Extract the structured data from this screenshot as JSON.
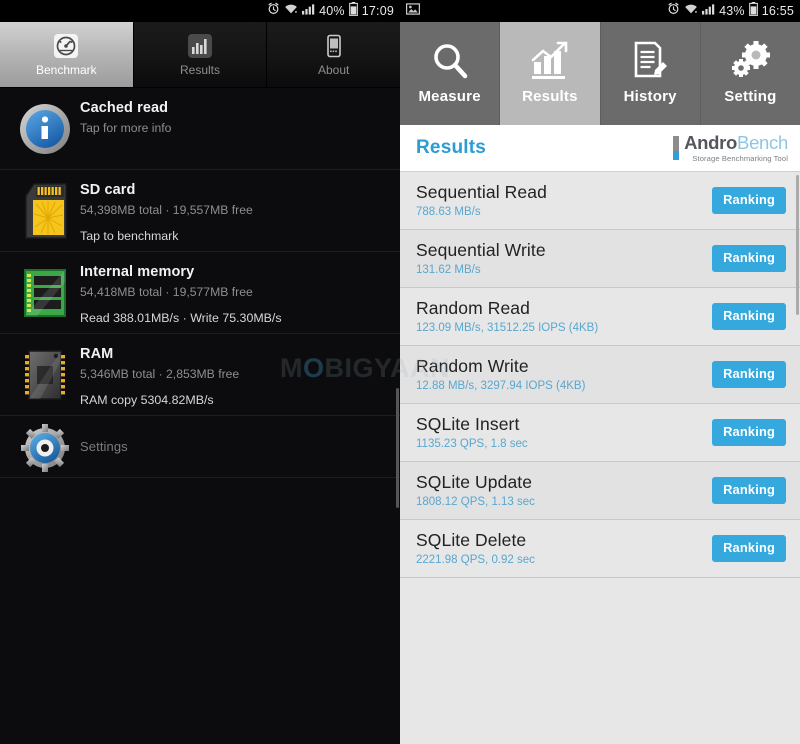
{
  "left_phone": {
    "status_bar": {
      "icons": [
        "alarm-icon",
        "wifi-icon",
        "signal-icon"
      ],
      "battery_percent": "40%",
      "battery_icon": "battery-icon",
      "time": "17:09"
    },
    "tabs": [
      {
        "label": "Benchmark",
        "icon": "gauge-icon",
        "selected": true
      },
      {
        "label": "Results",
        "icon": "bar-chart-icon",
        "selected": false
      },
      {
        "label": "About",
        "icon": "phone-icon",
        "selected": false
      }
    ],
    "items": [
      {
        "icon": "info-icon",
        "title": "Cached read",
        "sub": "Tap for more info",
        "action": ""
      },
      {
        "icon": "sd-card-icon",
        "title": "SD card",
        "sub": "54,398MB total · 19,557MB free",
        "action": "Tap to benchmark"
      },
      {
        "icon": "memory-icon",
        "title": "Internal memory",
        "sub": "54,418MB total · 19,577MB free",
        "action": "Read 388.01MB/s · Write 75.30MB/s"
      },
      {
        "icon": "ram-chip-icon",
        "title": "RAM",
        "sub": "5,346MB total · 2,853MB free",
        "action": "RAM copy 5304.82MB/s"
      },
      {
        "icon": "gear-icon",
        "title": "Settings",
        "sub": "",
        "action": ""
      }
    ]
  },
  "right_phone": {
    "status_bar": {
      "left_icon": "image-icon",
      "icons": [
        "alarm-icon",
        "wifi-icon",
        "signal-icon"
      ],
      "battery_percent": "43%",
      "battery_icon": "battery-icon",
      "time": "16:55"
    },
    "tabs": [
      {
        "label": "Measure",
        "icon": "magnifier-icon",
        "selected": false
      },
      {
        "label": "Results",
        "icon": "chart-up-icon",
        "selected": true
      },
      {
        "label": "History",
        "icon": "document-pen-icon",
        "selected": false
      },
      {
        "label": "Setting",
        "icon": "gears-icon",
        "selected": false
      }
    ],
    "header": {
      "title": "Results",
      "logo_primary": "Andro",
      "logo_secondary": "Bench",
      "logo_tagline": "Storage Benchmarking Tool"
    },
    "ranking_label": "Ranking",
    "results": [
      {
        "name": "Sequential Read",
        "value": "788.63 MB/s"
      },
      {
        "name": "Sequential Write",
        "value": "131.62 MB/s"
      },
      {
        "name": "Random Read",
        "value": "123.09 MB/s, 31512.25 IOPS (4KB)"
      },
      {
        "name": "Random Write",
        "value": "12.88 MB/s, 3297.94 IOPS (4KB)"
      },
      {
        "name": "SQLite Insert",
        "value": "1135.23 QPS, 1.8 sec"
      },
      {
        "name": "SQLite Update",
        "value": "1808.12 QPS, 1.13 sec"
      },
      {
        "name": "SQLite Delete",
        "value": "2221.98 QPS, 0.92 sec"
      }
    ]
  },
  "watermark": {
    "text_before": "M",
    "text_o": "O",
    "text_after": "BIGYAAN"
  },
  "colors": {
    "accent_blue": "#35a8dd",
    "header_blue": "#2c9cd3",
    "value_blue": "#59a7cf",
    "dark_bg": "#0c0c0e",
    "list_bg": "#e7e7e7",
    "tab_gray": "#6b6b6b",
    "tab_selected_gray": "#b9b9b9"
  }
}
